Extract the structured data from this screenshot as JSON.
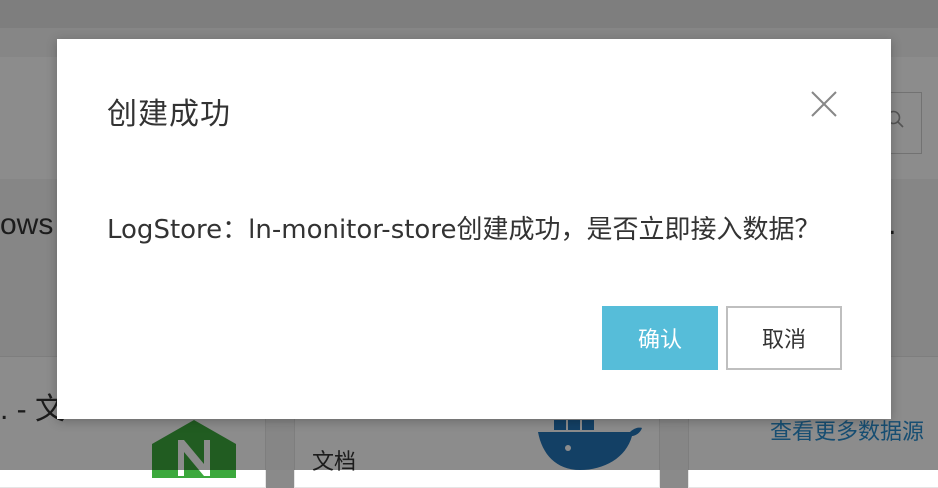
{
  "background": {
    "left_text": "ows",
    "right_text": ".",
    "card_title": ". - 文",
    "card_doc": "文档",
    "more_link": "查看更多数据源"
  },
  "dialog": {
    "title": "创建成功",
    "message": "LogStore：ln-monitor-store创建成功，是否立即接入数据？",
    "confirm_label": "确认",
    "cancel_label": "取消"
  },
  "colors": {
    "primary": "#56bdd9",
    "link": "#2b8ecf",
    "nginx_green": "#3ca83d",
    "docker_blue": "#2375b8"
  },
  "icons": {
    "close": "close-icon",
    "search": "search-icon",
    "nginx": "nginx-logo",
    "docker": "docker-logo"
  }
}
